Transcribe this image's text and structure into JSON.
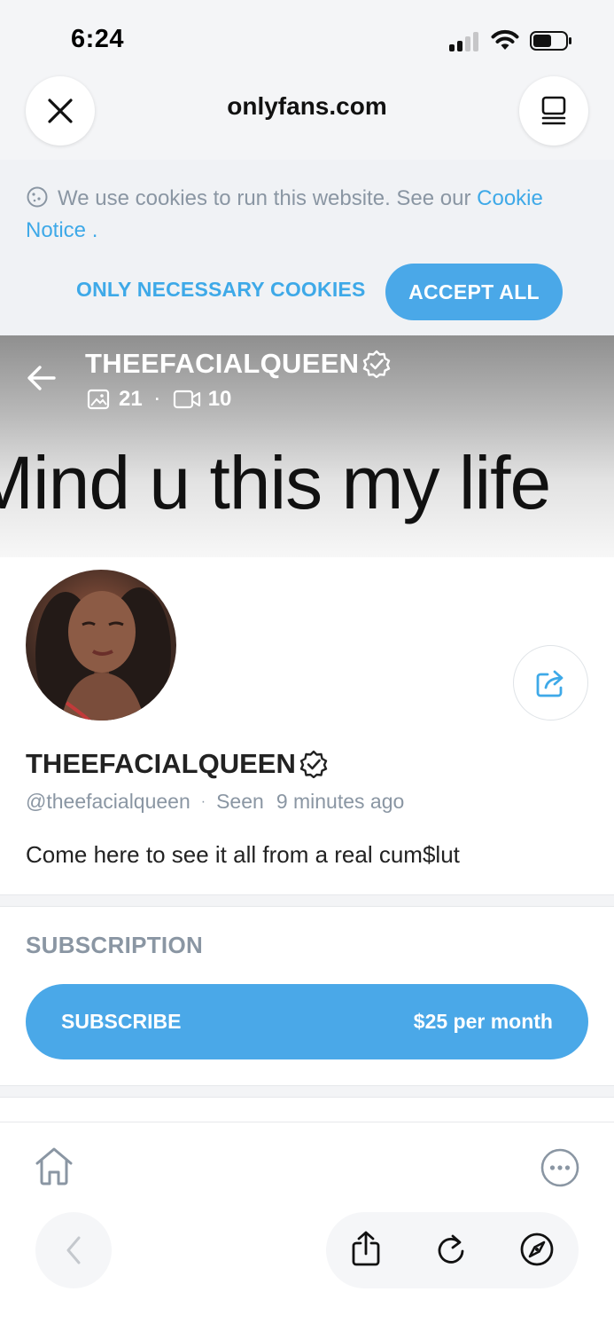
{
  "status_bar": {
    "time": "6:24"
  },
  "browser": {
    "url": "onlyfans.com"
  },
  "cookie_banner": {
    "text": "We use cookies to run this website. See our",
    "link_text": "Cookie Notice",
    "trailing": " .",
    "necessary_label": "ONLY NECESSARY COOKIES",
    "accept_label": "ACCEPT ALL"
  },
  "cover": {
    "name": "THEEFACIALQUEEN",
    "photos_count": "21",
    "separator": "·",
    "videos_count": "10",
    "banner_text": "Mind u this my life"
  },
  "profile": {
    "name": "THEEFACIALQUEEN",
    "handle": "@theefacialqueen",
    "separator": "·",
    "seen_label": "Seen",
    "seen_time": "9 minutes ago",
    "bio": "Come here to see it all from a real cum$lut"
  },
  "subscription": {
    "heading": "SUBSCRIPTION",
    "button_label": "SUBSCRIBE",
    "price": "$25 per month"
  },
  "colors": {
    "accent": "#4aa8e8",
    "link": "#3ea9e8",
    "muted": "#8a96a3"
  }
}
